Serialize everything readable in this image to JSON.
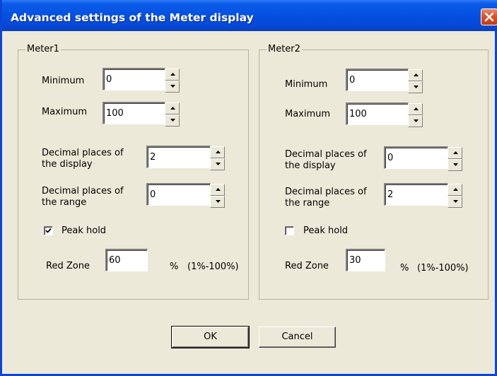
{
  "window": {
    "title": "Advanced settings of the Meter display"
  },
  "meter1": {
    "legend": "Meter1",
    "minimum_label": "Minimum",
    "minimum_value": "0",
    "maximum_label": "Maximum",
    "maximum_value": "100",
    "decimal_display_label_line1": "Decimal places of",
    "decimal_display_label_line2": "the display",
    "decimal_display_value": "2",
    "decimal_range_label_line1": "Decimal places of",
    "decimal_range_label_line2": "the range",
    "decimal_range_value": "0",
    "peak_hold_label": "Peak hold",
    "peak_hold_checked": true,
    "red_zone_label": "Red Zone",
    "red_zone_value": "60",
    "percent_sign": "%",
    "range_hint": "(1%-100%)"
  },
  "meter2": {
    "legend": "Meter2",
    "minimum_label": "Minimum",
    "minimum_value": "0",
    "maximum_label": "Maximum",
    "maximum_value": "100",
    "decimal_display_label_line1": "Decimal places of",
    "decimal_display_label_line2": "the display",
    "decimal_display_value": "0",
    "decimal_range_label_line1": "Decimal places of",
    "decimal_range_label_line2": "the range",
    "decimal_range_value": "2",
    "peak_hold_label": "Peak hold",
    "peak_hold_checked": false,
    "red_zone_label": "Red Zone",
    "red_zone_value": "30",
    "percent_sign": "%",
    "range_hint": "(1%-100%)"
  },
  "buttons": {
    "ok_label": "OK",
    "cancel_label": "Cancel"
  },
  "icons": {
    "close": "close-icon",
    "spin_up": "arrow-up-icon",
    "spin_down": "arrow-down-icon",
    "check": "checkmark-icon"
  },
  "colors": {
    "titlebar": "#0550e0",
    "dialog_bg": "#ece9d8",
    "close_button": "#d9542c"
  }
}
